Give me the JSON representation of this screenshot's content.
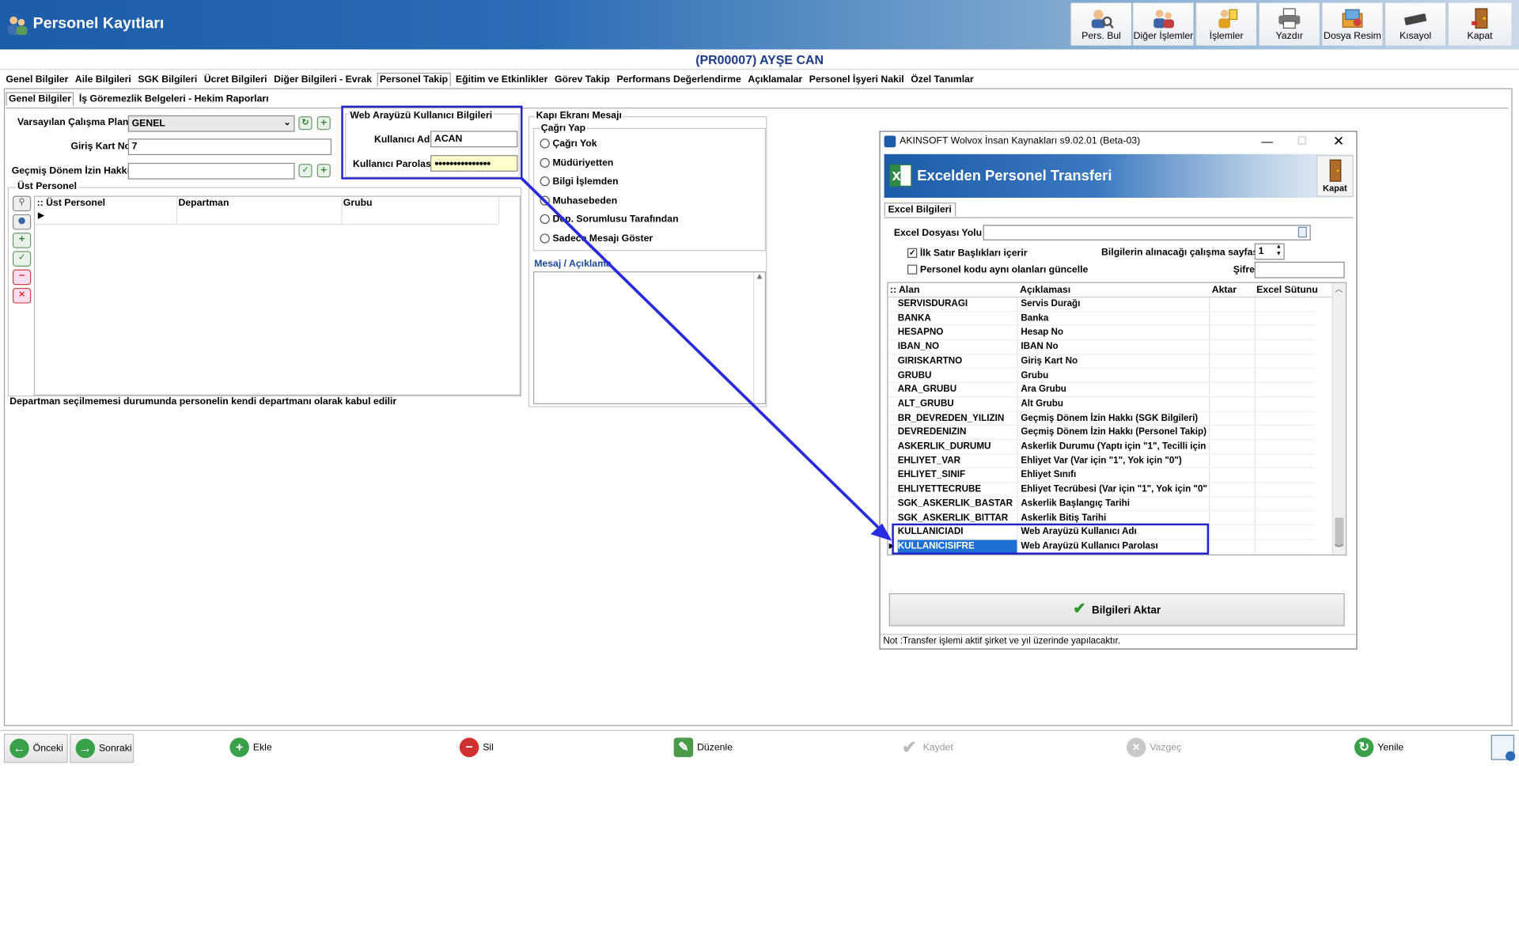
{
  "window": {
    "title": "Personel Kayıtları"
  },
  "toolbar": [
    {
      "id": "pers-bul",
      "label": "Pers. Bul"
    },
    {
      "id": "diger-islemler",
      "label": "Diğer İşlemler"
    },
    {
      "id": "islemler",
      "label": "İşlemler"
    },
    {
      "id": "yazdir",
      "label": "Yazdır"
    },
    {
      "id": "dosya-resim",
      "label": "Dosya Resim"
    },
    {
      "id": "kisayol",
      "label": "Kısayol"
    },
    {
      "id": "kapat",
      "label": "Kapat"
    }
  ],
  "record": {
    "title": "(PR00007) AYŞE CAN"
  },
  "tabs": [
    "Genel Bilgiler",
    "Aile Bilgileri",
    "SGK Bilgileri",
    "Ücret Bilgileri",
    "Diğer Bilgileri - Evrak",
    "Personel Takip",
    "Eğitim ve Etkinlikler",
    "Görev Takip",
    "Performans Değerlendirme",
    "Açıklamalar",
    "Personel İşyeri Nakil",
    "Özel Tanımlar"
  ],
  "active_tab": "Personel Takip",
  "subtabs": [
    "Genel Bilgiler",
    "İş Göremezlik Belgeleri - Hekim Raporları"
  ],
  "form": {
    "calisma_plani_label": "Varsayılan Çalışma Planı",
    "calisma_plani_value": "GENEL",
    "giris_kart_label": "Giriş Kart No",
    "giris_kart_value": "7",
    "gecmis_izin_label": "Geçmiş Dönem İzin Hakkı",
    "gecmis_izin_value": "",
    "ust_personel_label": "Üst Personel",
    "grid_headers": [
      "Üst Personel",
      "Departman",
      "Grubu"
    ],
    "note": "Departman seçilmemesi durumunda personelin kendi departmanı olarak kabul edilir"
  },
  "web": {
    "group_label": "Web Arayüzü Kullanıcı Bilgileri",
    "user_label": "Kullanıcı Adı",
    "user_value": "ACAN",
    "pass_label": "Kullanıcı Parolası",
    "pass_value": "●●●●●●●●●●●●●●●"
  },
  "kapi": {
    "group_label": "Kapı Ekranı Mesajı",
    "cagri_label": "Çağrı Yap",
    "options": [
      "Çağrı Yok",
      "Müdüriyetten",
      "Bilgi İşlemden",
      "Muhasebeden",
      "Dep. Sorumlusu Tarafından",
      "Sadece Mesajı Göster"
    ],
    "mesaj_label": "Mesaj / Açıklama"
  },
  "dialog": {
    "title": "AKINSOFT Wolvox İnsan Kaynakları s9.02.01 (Beta-03)",
    "banner": "Excelden Personel Transferi",
    "close_label": "Kapat",
    "tab": "Excel Bilgileri",
    "excel_path_label": "Excel Dosyası Yolu",
    "chk1": "İlk Satır Başlıkları içerir",
    "chk2": "Personel kodu aynı olanları güncelle",
    "sheet_label": "Bilgilerin alınacağı çalışma sayfası",
    "sheet_value": "1",
    "sifre_label": "Şifre",
    "headers": [
      "Alan",
      "Açıklaması",
      "Aktar",
      "Excel Sütunu"
    ],
    "rows": [
      [
        "SERVISDURAGI",
        "Servis Durağı"
      ],
      [
        "BANKA",
        "Banka"
      ],
      [
        "HESAPNO",
        "Hesap No"
      ],
      [
        "IBAN_NO",
        "IBAN No"
      ],
      [
        "GIRISKARTNO",
        "Giriş Kart No"
      ],
      [
        "GRUBU",
        "Grubu"
      ],
      [
        "ARA_GRUBU",
        "Ara Grubu"
      ],
      [
        "ALT_GRUBU",
        "Alt Grubu"
      ],
      [
        "BR_DEVREDEN_YILIZIN",
        "Geçmiş Dönem İzin Hakkı (SGK Bilgileri)"
      ],
      [
        "DEVREDENIZIN",
        "Geçmiş Dönem İzin Hakkı (Personel Takip)"
      ],
      [
        "ASKERLIK_DURUMU",
        "Askerlik Durumu (Yaptı için \"1\", Tecilli için"
      ],
      [
        "EHLIYET_VAR",
        "Ehliyet Var (Var için \"1\", Yok için \"0\")"
      ],
      [
        "EHLIYET_SINIF",
        "Ehliyet Sınıfı"
      ],
      [
        "EHLIYETTECRUBE",
        "Ehliyet Tecrübesi (Var için \"1\", Yok için \"0\""
      ],
      [
        "SGK_ASKERLIK_BASTAR",
        "Askerlik Başlangıç Tarihi"
      ],
      [
        "SGK_ASKERLIK_BITTAR",
        "Askerlik Bitiş Tarihi"
      ],
      [
        "KULLANICIADI",
        "Web Arayüzü Kullanıcı Adı"
      ],
      [
        "KULLANICISIFRE",
        "Web Arayüzü Kullanıcı Parolası"
      ]
    ],
    "transfer_label": "Bilgileri Aktar",
    "note": "Not :Transfer işlemi aktif şirket ve yıl üzerinde yapılacaktır."
  },
  "bottom": [
    {
      "id": "onceki",
      "label": "Önceki"
    },
    {
      "id": "sonraki",
      "label": "Sonraki"
    },
    {
      "id": "ekle",
      "label": "Ekle"
    },
    {
      "id": "sil",
      "label": "Sil"
    },
    {
      "id": "duzenle",
      "label": "Düzenle"
    },
    {
      "id": "kaydet",
      "label": "Kaydet"
    },
    {
      "id": "vazgec",
      "label": "Vazgeç"
    },
    {
      "id": "yenile",
      "label": "Yenile"
    }
  ],
  "colors": {
    "accent": "#1d5da8",
    "highlight": "#2222cc",
    "selection": "#1e6fd2"
  }
}
